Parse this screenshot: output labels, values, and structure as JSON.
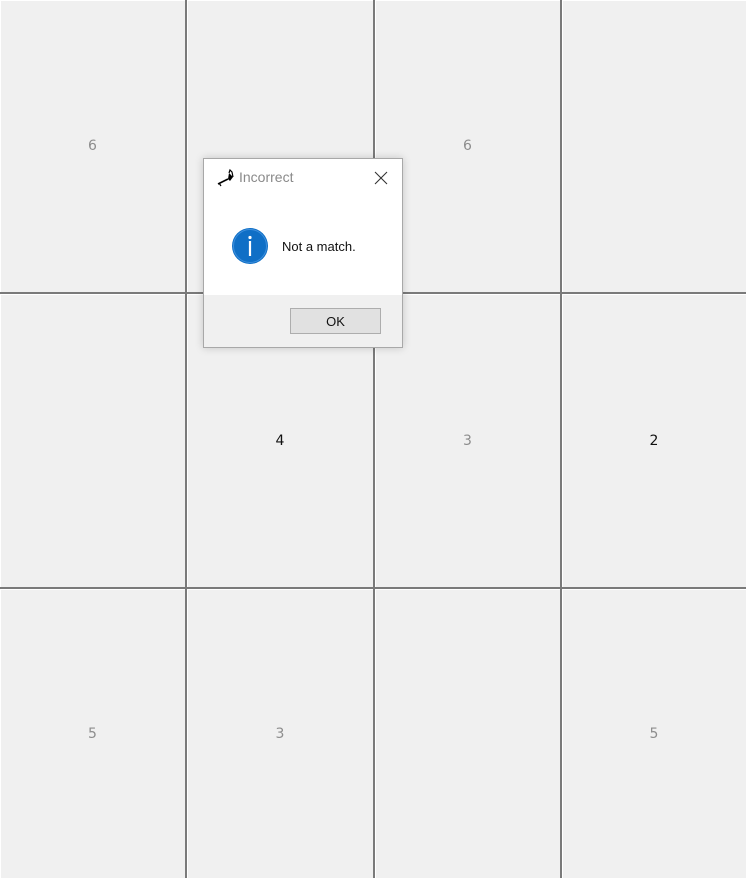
{
  "board": {
    "tiles": [
      {
        "label": "6",
        "state": "dim"
      },
      {
        "label": "",
        "state": "dim"
      },
      {
        "label": "6",
        "state": "dim"
      },
      {
        "label": "",
        "state": "dim"
      },
      {
        "label": "",
        "state": "dim"
      },
      {
        "label": "4",
        "state": "active"
      },
      {
        "label": "3",
        "state": "dim"
      },
      {
        "label": "2",
        "state": "active"
      },
      {
        "label": "5",
        "state": "dim"
      },
      {
        "label": "3",
        "state": "dim"
      },
      {
        "label": "",
        "state": "dim"
      },
      {
        "label": "5",
        "state": "dim"
      }
    ]
  },
  "dialog": {
    "title": "Incorrect",
    "message": "Not a match.",
    "ok_label": "OK",
    "icon": "information-icon",
    "accent_color": "#0f6fc6"
  }
}
